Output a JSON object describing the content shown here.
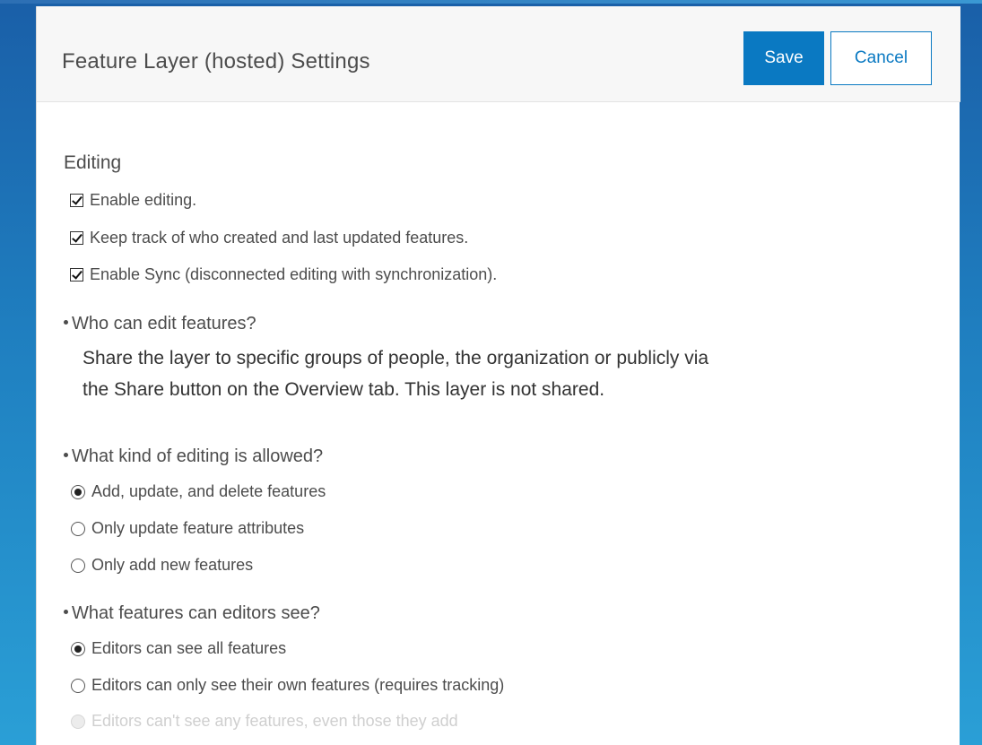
{
  "panel": {
    "title": "Feature Layer (hosted) Settings",
    "save_label": "Save",
    "cancel_label": "Cancel"
  },
  "editing": {
    "section_title": "Editing",
    "checkboxes": [
      {
        "label": "Enable editing.",
        "checked": true
      },
      {
        "label": "Keep track of who created and last updated features.",
        "checked": true
      },
      {
        "label": "Enable Sync (disconnected editing with synchronization).",
        "checked": true
      }
    ],
    "who_can_edit": {
      "question": "Who can edit features?",
      "description_line1": "Share the layer to specific groups of people, the organization or publicly via",
      "description_line2": "the Share button on the Overview tab. This layer is not shared."
    },
    "editing_allowed": {
      "question": "What kind of editing is allowed?",
      "options": [
        {
          "label": "Add, update, and delete features",
          "selected": true
        },
        {
          "label": "Only update feature attributes",
          "selected": false
        },
        {
          "label": "Only add new features",
          "selected": false
        }
      ]
    },
    "editors_see": {
      "question": "What features can editors see?",
      "options": [
        {
          "label": "Editors can see all features",
          "selected": true,
          "disabled": false
        },
        {
          "label": "Editors can only see their own features (requires tracking)",
          "selected": false,
          "disabled": false
        },
        {
          "label": "Editors can't see any features, even those they add",
          "selected": false,
          "disabled": true
        }
      ]
    }
  },
  "colors": {
    "accent": "#0a79c2",
    "text": "#4c4c4c",
    "header_bg": "#f7f7f7",
    "disabled_text": "#cfcfcf"
  }
}
